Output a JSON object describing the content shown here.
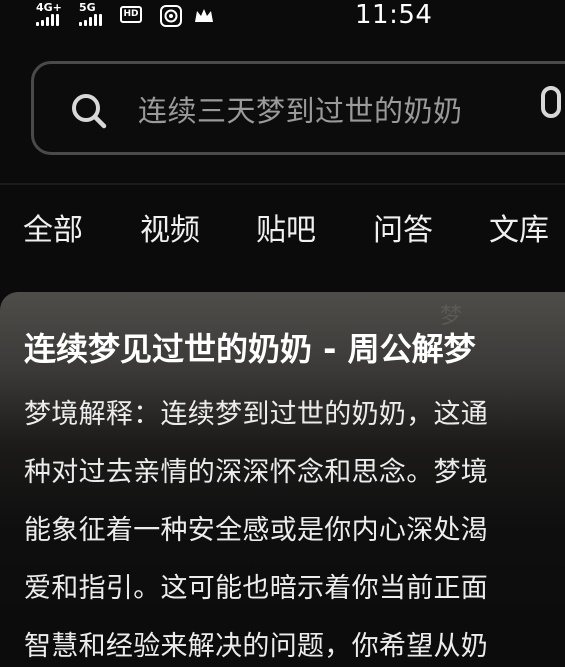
{
  "status_bar": {
    "network_1": "4G+",
    "network_2": "5G",
    "hd_badge": "HD",
    "clock": "11:54",
    "icons": [
      "signal-icon",
      "hd-voice-icon",
      "sim-app-icon",
      "crown-icon"
    ]
  },
  "search": {
    "query": "连续三天梦到过世的奶奶",
    "icon": "search-icon",
    "voice_icon": "mic-icon"
  },
  "tabs": [
    {
      "label": "全部"
    },
    {
      "label": "视频"
    },
    {
      "label": "贴吧"
    },
    {
      "label": "问答"
    },
    {
      "label": "文库"
    }
  ],
  "result": {
    "title": "连续梦见过世的奶奶 - 周公解梦",
    "decor_text": "梦",
    "lines": [
      "梦境解释：连续梦到过世的奶奶，这通",
      "种对过去亲情的深深怀念和思念。梦境",
      "能象征着一种安全感或是你内心深处渴",
      "爱和指引。这可能也暗示着你当前正面",
      "智慧和经验来解决的问题，你希望从奶"
    ]
  },
  "colors": {
    "background": "#0b0b0b",
    "search_border": "#4a4a4a",
    "placeholder_text": "#9a9a9a",
    "card_top": "#4e4d4a"
  }
}
